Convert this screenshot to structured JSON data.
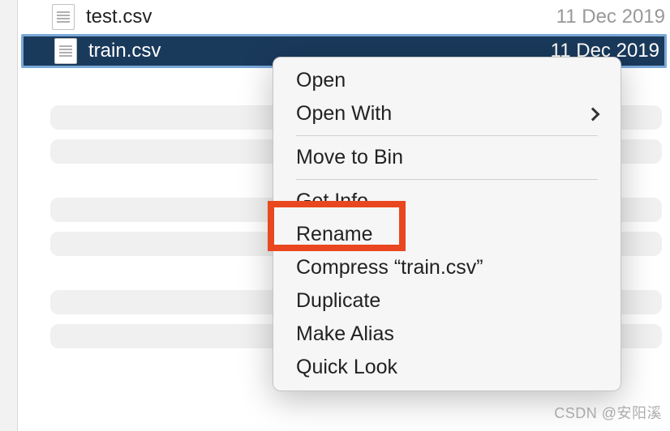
{
  "files": [
    {
      "name": "test.csv",
      "date": "11 Dec 2019",
      "selected": false
    },
    {
      "name": "train.csv",
      "date": "11 Dec 2019",
      "selected": true
    }
  ],
  "context_menu": {
    "items": [
      {
        "label": "Open",
        "has_submenu": false
      },
      {
        "label": "Open With",
        "has_submenu": true
      },
      {
        "sep": true
      },
      {
        "label": "Move to Bin",
        "has_submenu": false
      },
      {
        "sep": true
      },
      {
        "label": "Get Info",
        "has_submenu": false,
        "highlighted": true
      },
      {
        "label": "Rename",
        "has_submenu": false
      },
      {
        "label": "Compress “train.csv”",
        "has_submenu": false
      },
      {
        "label": "Duplicate",
        "has_submenu": false
      },
      {
        "label": "Make Alias",
        "has_submenu": false
      },
      {
        "label": "Quick Look",
        "has_submenu": false
      }
    ]
  },
  "watermark": "CSDN @安阳溪"
}
